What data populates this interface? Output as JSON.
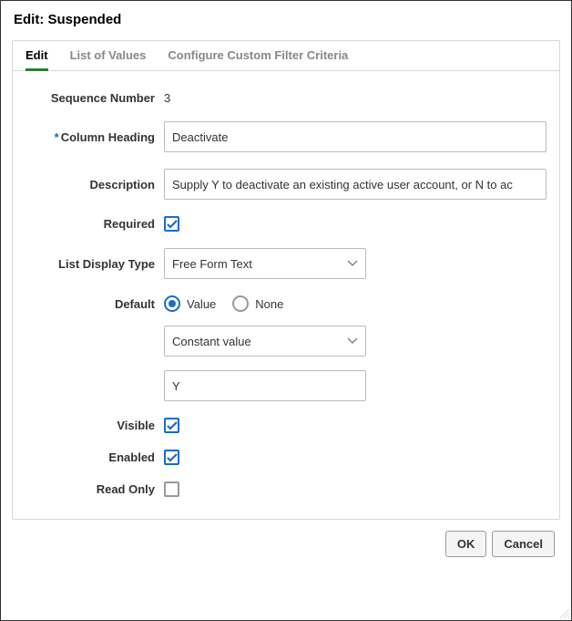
{
  "dialog": {
    "title": "Edit: Suspended"
  },
  "tabs": {
    "edit": "Edit",
    "list_of_values": "List of Values",
    "configure_filter": "Configure Custom Filter Criteria"
  },
  "labels": {
    "sequence_number": "Sequence Number",
    "column_heading": "Column Heading",
    "description": "Description",
    "required": "Required",
    "list_display_type": "List Display Type",
    "default": "Default",
    "visible": "Visible",
    "enabled": "Enabled",
    "read_only": "Read Only"
  },
  "values": {
    "sequence_number": "3",
    "column_heading": "Deactivate",
    "description": "Supply Y to deactivate an existing active user account, or N to ac",
    "required_checked": true,
    "list_display_type": "Free Form Text",
    "default_mode": "Value",
    "default_type": "Constant value",
    "default_value": "Y",
    "visible_checked": true,
    "enabled_checked": true,
    "read_only_checked": false
  },
  "radio_options": {
    "value": "Value",
    "none": "None"
  },
  "buttons": {
    "ok": "OK",
    "cancel": "Cancel"
  }
}
